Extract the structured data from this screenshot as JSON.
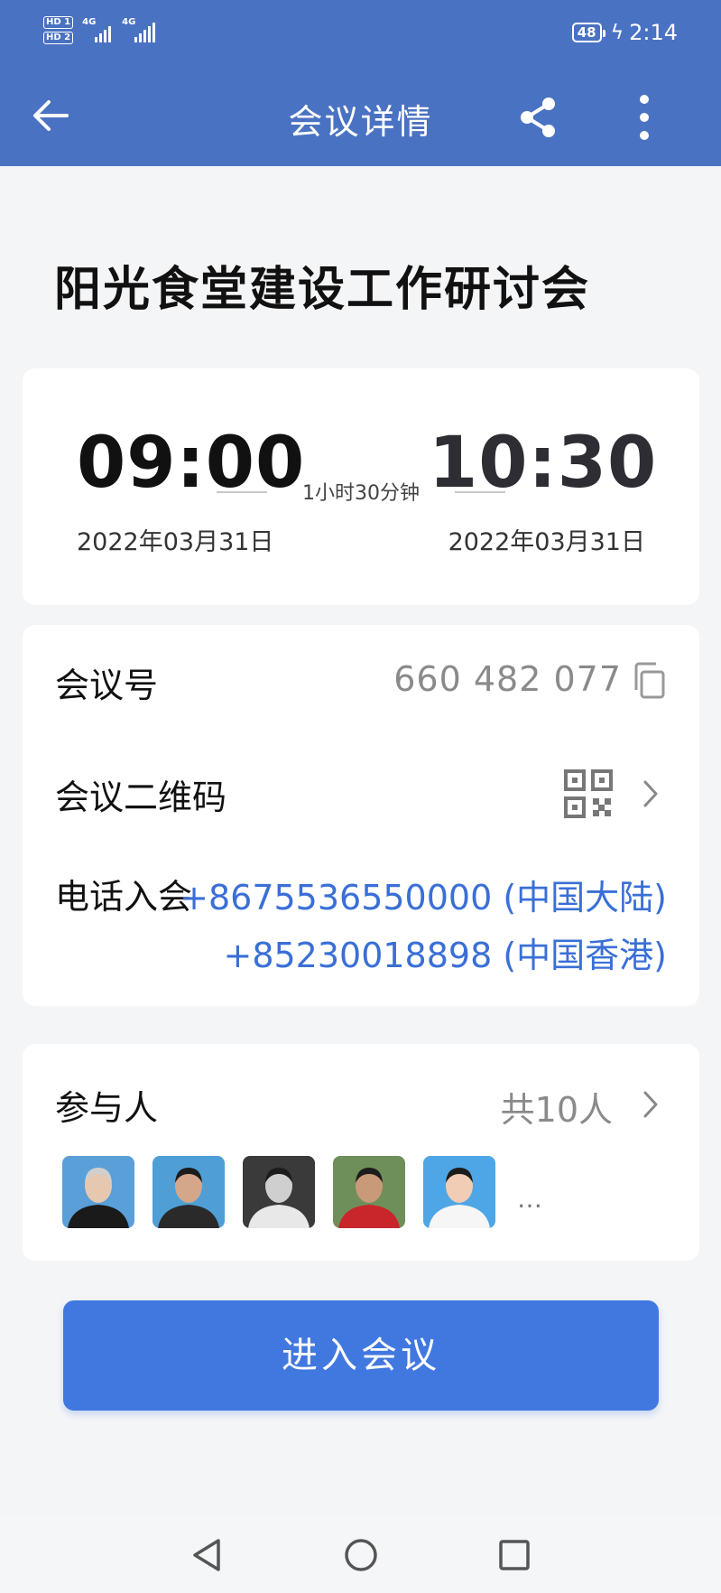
{
  "status_bar": {
    "hd1": "HD 1",
    "hd2": "HD 2",
    "net1": "4G",
    "net2": "4G",
    "battery": "48",
    "time": "2:14"
  },
  "app_bar": {
    "title": "会议详情",
    "icons": [
      "arrow-left-icon",
      "share-icon",
      "more-vertical-icon"
    ]
  },
  "meeting": {
    "title": "阳光食堂建设工作研讨会",
    "start_time": "09:00",
    "start_date": "2022年03月31日",
    "end_time": "10:30",
    "end_date": "2022年03月31日",
    "duration": "1小时30分钟"
  },
  "info": {
    "id_label": "会议号",
    "id_value": "660 482 077",
    "qr_label": "会议二维码",
    "phone_label": "电话入会",
    "phones": [
      "+8675536550000 (中国大陆)",
      "+85230018898 (中国香港)"
    ]
  },
  "participants": {
    "label": "参与人",
    "count": "共10人",
    "more": "…",
    "avatars": [
      {
        "bg": "#5a9fd8",
        "skin": "#e6c8b0",
        "cloth": "#1a1a1a"
      },
      {
        "bg": "#4f9fd6",
        "skin": "#d4a78a",
        "cloth": "#2a2a2a"
      },
      {
        "bg": "#3a3a3a",
        "skin": "#cfcfcf",
        "cloth": "#e8e8e8"
      },
      {
        "bg": "#6f8f5a",
        "skin": "#c99a7a",
        "cloth": "#c8262a"
      },
      {
        "bg": "#4fa6e6",
        "skin": "#f0cdb4",
        "cloth": "#f6f6f6"
      }
    ]
  },
  "join_button": "进入会议",
  "colors": {
    "header": "#4a72c2",
    "accent": "#4178e0",
    "link": "#3a6fd6"
  }
}
